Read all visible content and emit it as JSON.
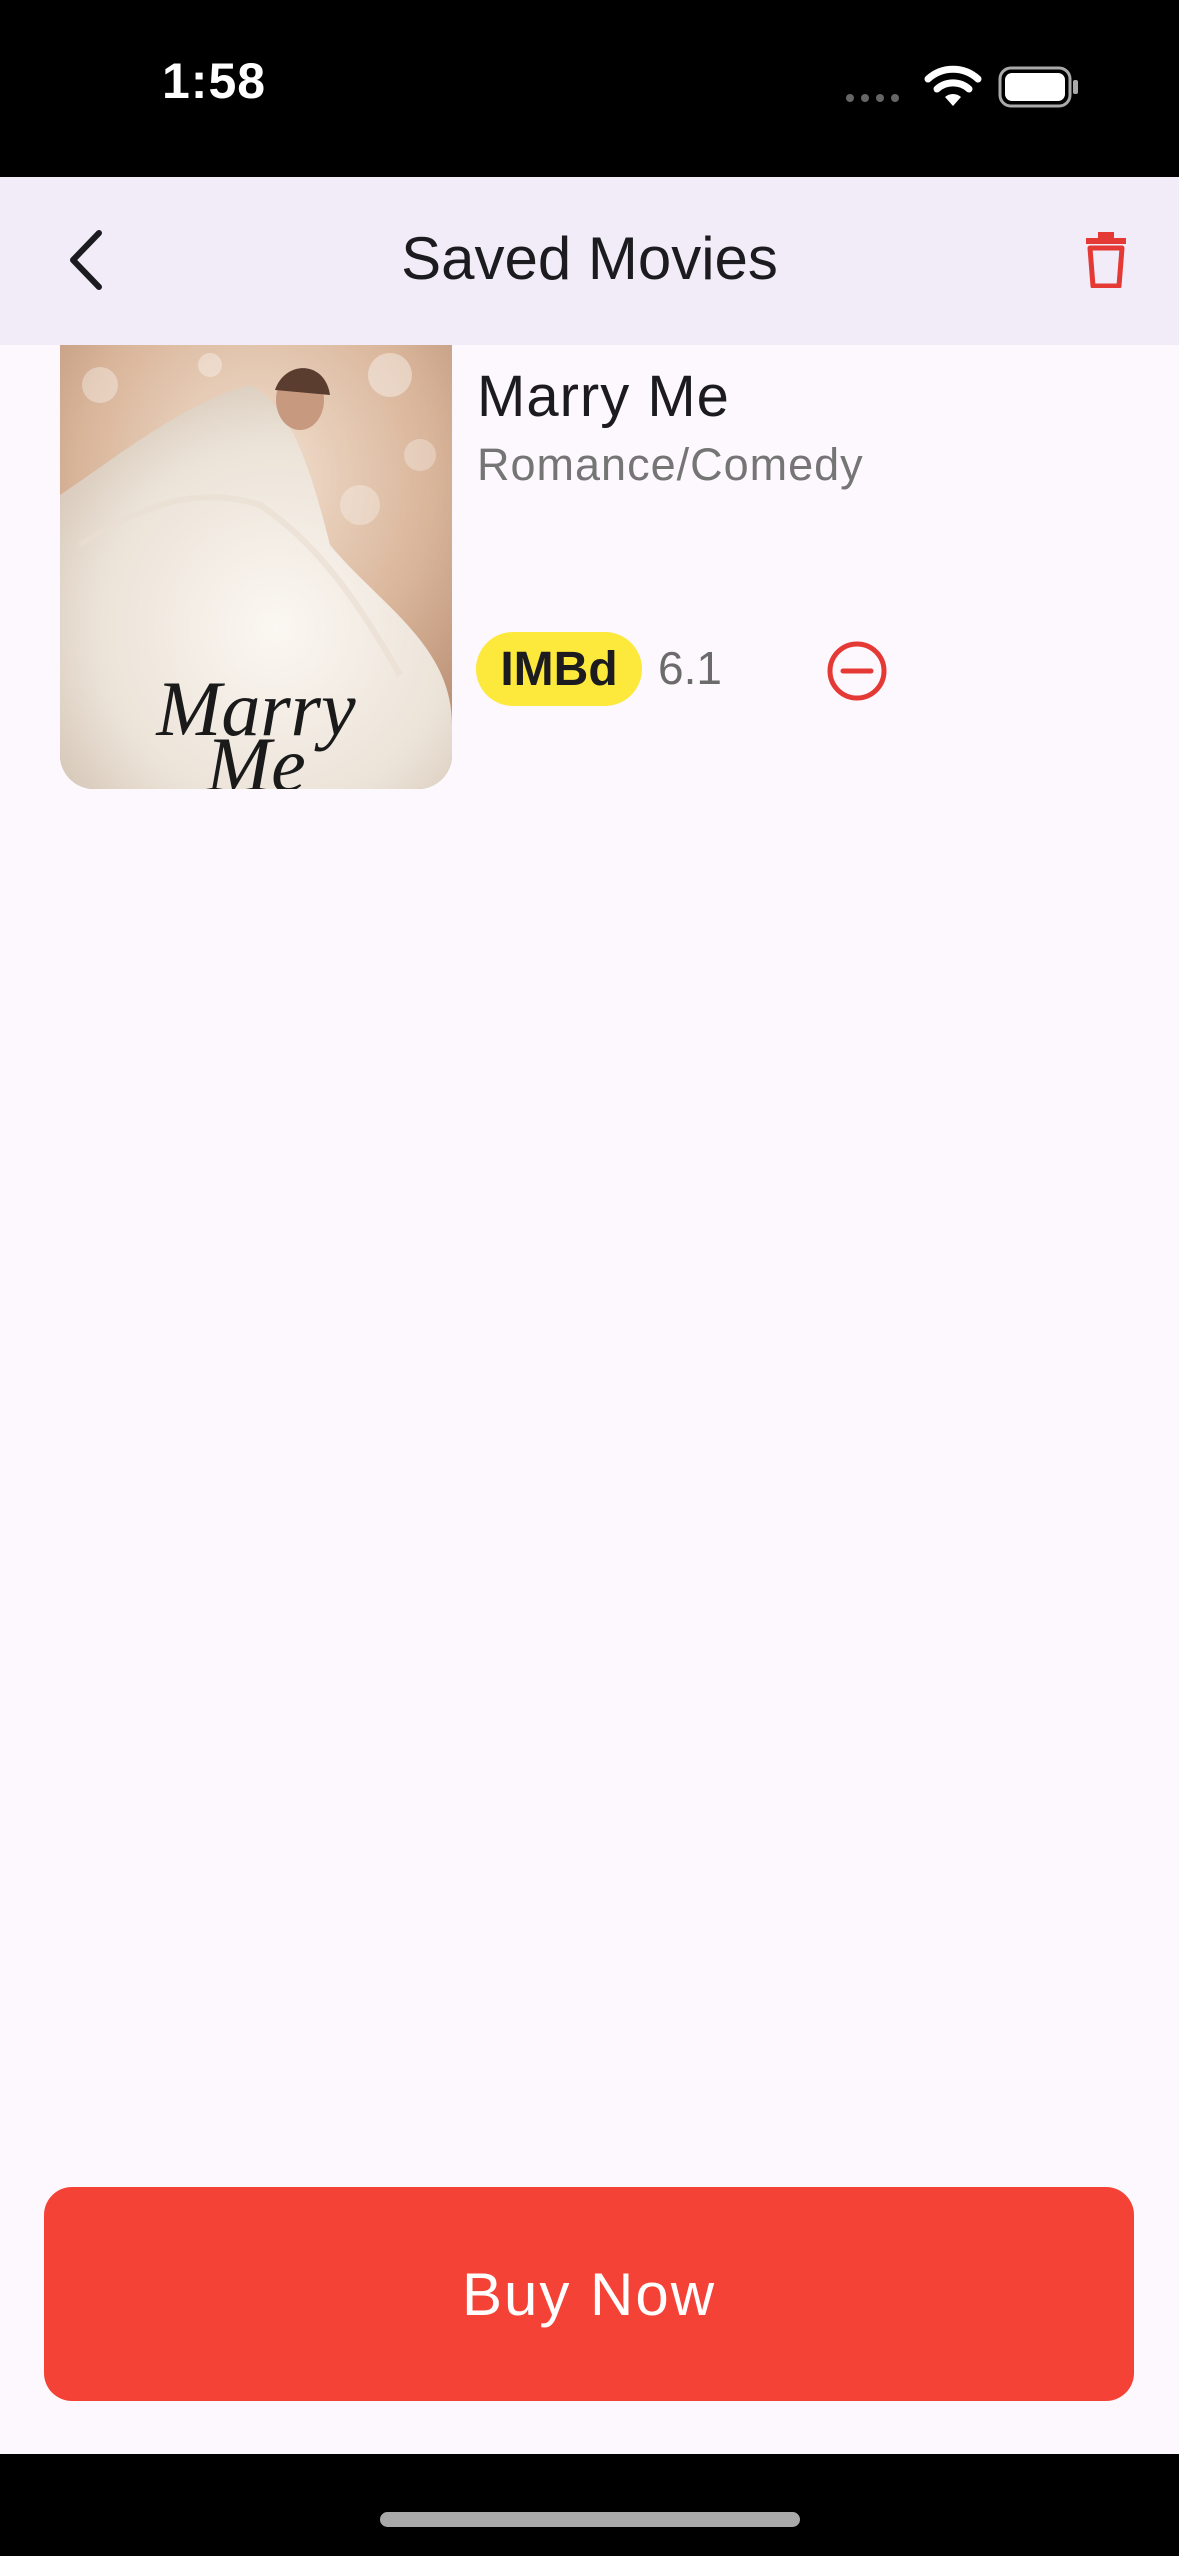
{
  "status_bar": {
    "time": "1:58",
    "icons": [
      "signal-dots-icon",
      "wifi-icon",
      "battery-icon"
    ]
  },
  "app_bar": {
    "title": "Saved Movies",
    "back_icon": "chevron-left-icon",
    "delete_icon": "trash-icon"
  },
  "saved_movies": [
    {
      "title": "Marry Me",
      "genre": "Romance/Comedy",
      "rating_badge": "IMBd",
      "rating": "6.1",
      "poster_text_line1": "Marry",
      "poster_text_line2": "Me",
      "remove_icon": "minus-circle-icon"
    }
  ],
  "buy_button": {
    "label": "Buy Now"
  },
  "colors": {
    "accent_red": "#f44336",
    "badge_yellow": "#fde93b",
    "app_bar_bg": "#f1ecf8",
    "page_bg": "#fdf7fe"
  }
}
